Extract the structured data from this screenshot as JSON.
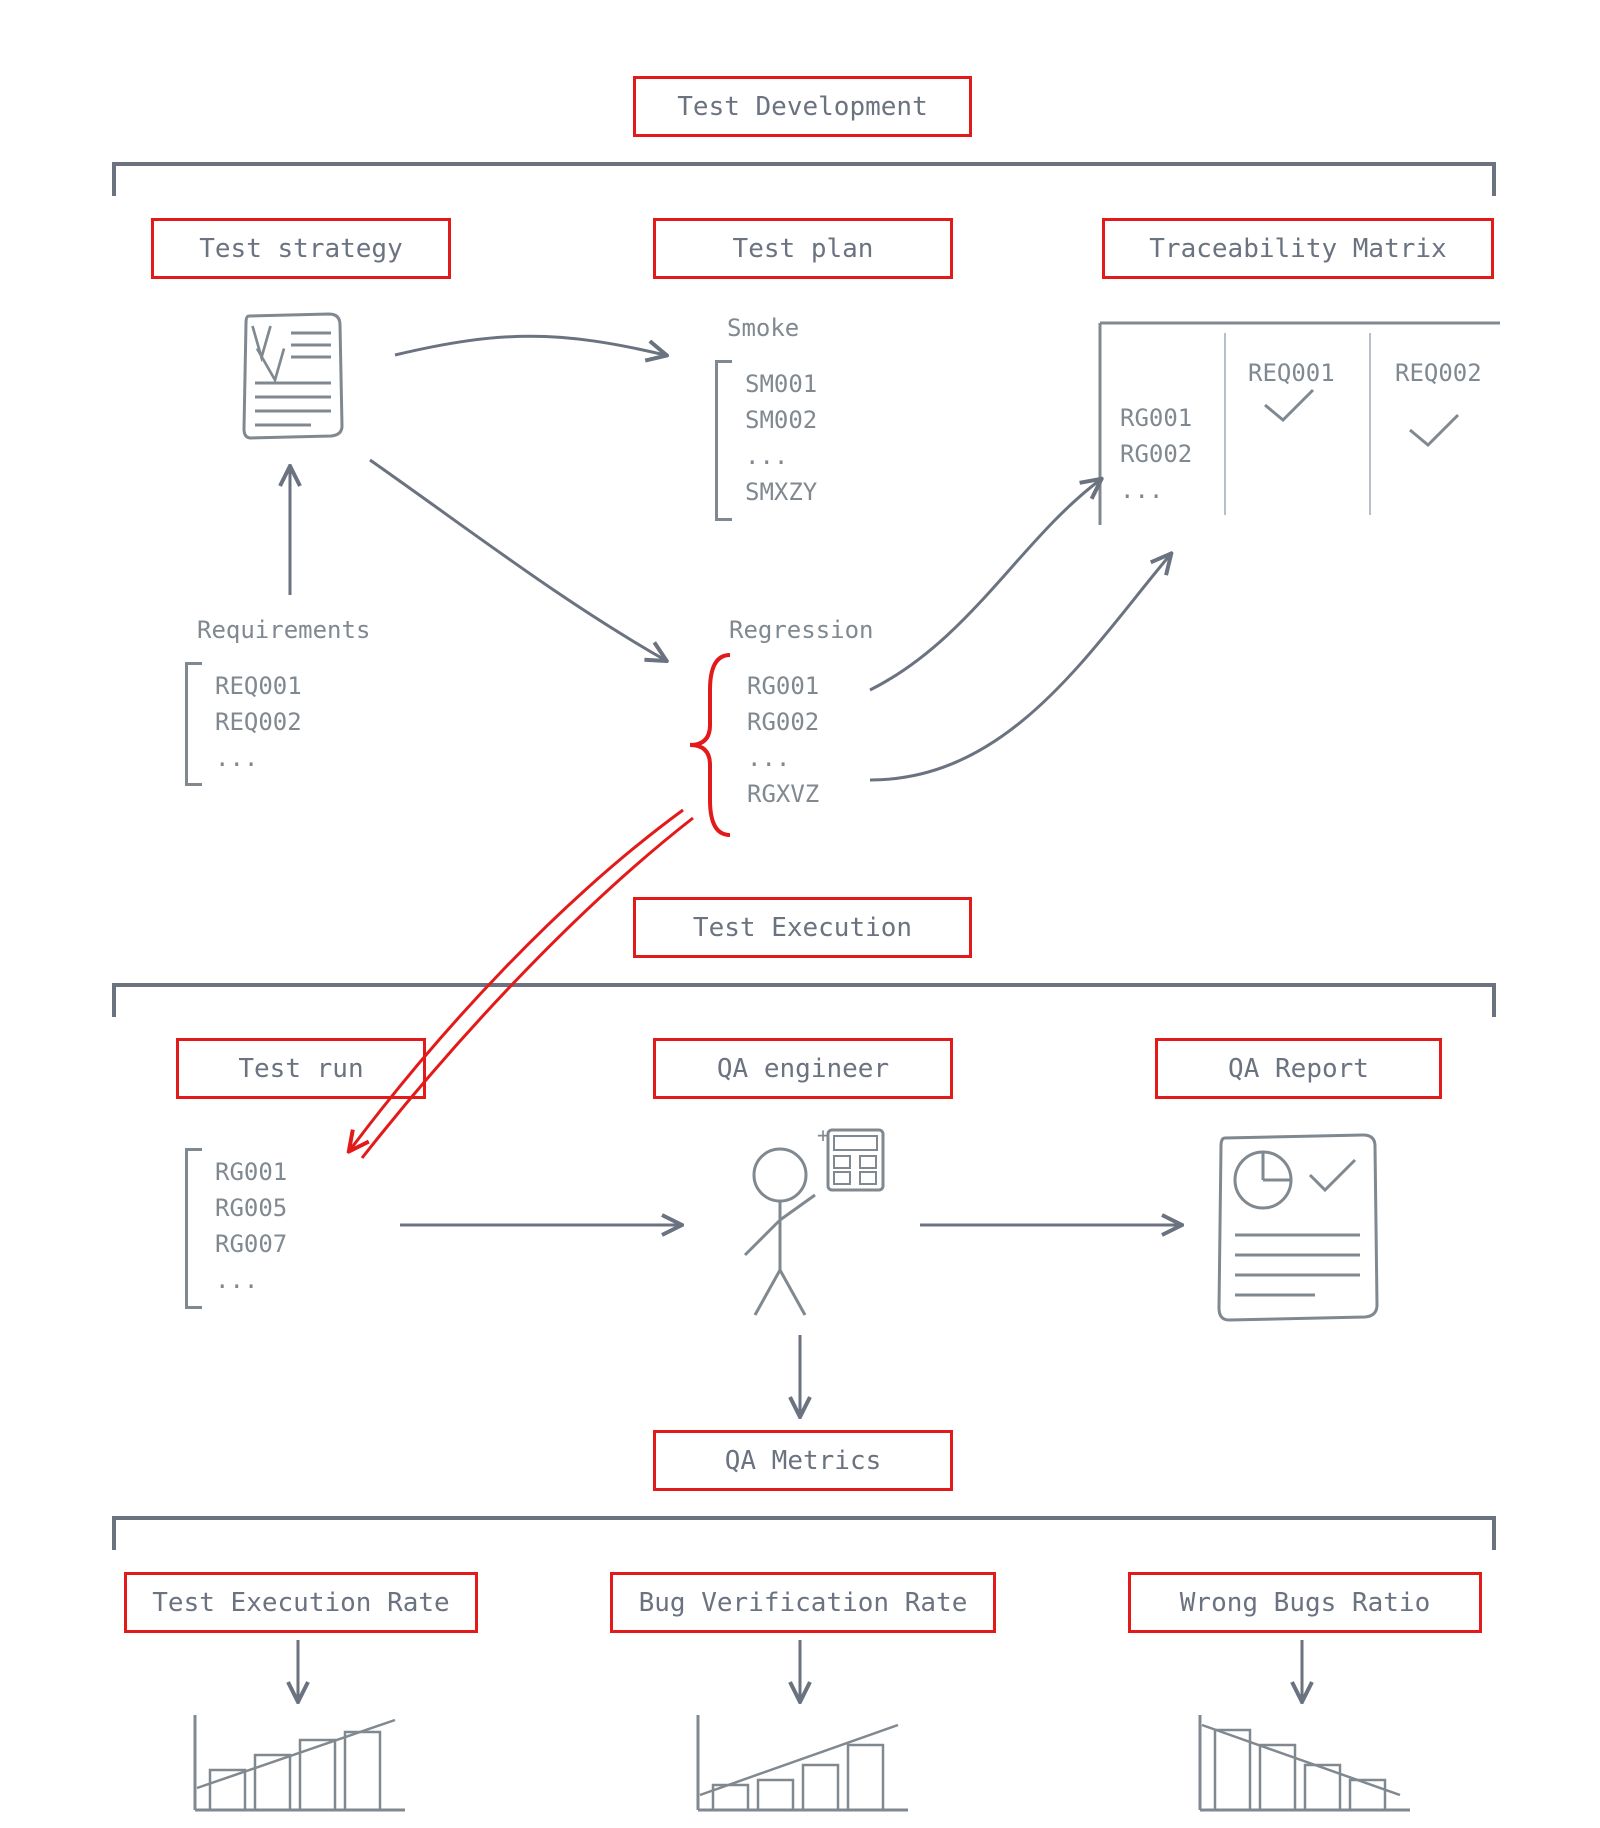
{
  "sections": {
    "dev": "Test Development",
    "exec": "Test Execution",
    "metrics": "QA Metrics"
  },
  "dev_cols": {
    "strategy": "Test strategy",
    "plan": "Test plan",
    "trace": "Traceability Matrix"
  },
  "exec_cols": {
    "run": "Test run",
    "qa": "QA engineer",
    "report": "QA Report"
  },
  "metrics_cols": {
    "rate": "Test Execution Rate",
    "bug": "Bug Verification Rate",
    "wrong": "Wrong Bugs Ratio"
  },
  "requirements": {
    "title": "Requirements",
    "items": "REQ001\nREQ002\n..."
  },
  "smoke": {
    "title": "Smoke",
    "items": "SM001\nSM002\n...\nSMXZY"
  },
  "regression": {
    "title": "Regression",
    "items": "RG001\nRG002\n...\nRGXVZ"
  },
  "trace_matrix": {
    "c1": "REQ001",
    "c2": "REQ002",
    "rows": "RG001\nRG002\n..."
  },
  "testrun": {
    "items": "RG001\nRG005\nRG007\n..."
  }
}
